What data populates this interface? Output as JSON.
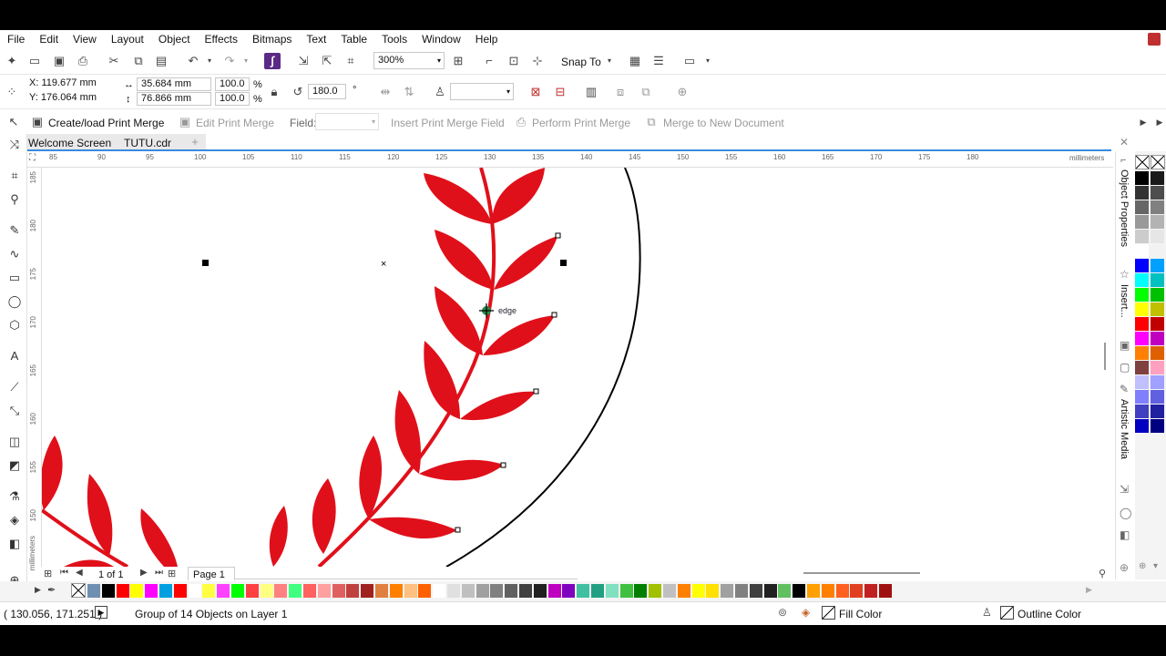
{
  "menu": [
    "File",
    "Edit",
    "View",
    "Layout",
    "Object",
    "Effects",
    "Bitmaps",
    "Text",
    "Table",
    "Tools",
    "Window",
    "Help"
  ],
  "toolbar": {
    "zoom": "300%",
    "snap_to": "Snap To"
  },
  "propbar": {
    "x": "X: 119.677 mm",
    "y": "Y: 176.064 mm",
    "width": "35.684 mm",
    "height": "76.866 mm",
    "scale_w": "100.0",
    "scale_h": "100.0",
    "percent": "%",
    "angle": "180.0",
    "degree": "°"
  },
  "printmerge": {
    "create": "Create/load Print Merge",
    "edit": "Edit Print Merge",
    "field": "Field:",
    "insert": "Insert Print Merge Field",
    "perform": "Perform Print Merge",
    "merge_doc": "Merge to New Document"
  },
  "tabs": [
    "Welcome Screen",
    "TUTU.cdr"
  ],
  "ruler": {
    "unit": "millimeters",
    "h_ticks": [
      "85",
      "90",
      "95",
      "100",
      "105",
      "110",
      "115",
      "120",
      "125",
      "130",
      "135",
      "140",
      "145",
      "150",
      "155",
      "160",
      "165",
      "170",
      "175",
      "180"
    ],
    "v_ticks": [
      "185",
      "180",
      "175",
      "170",
      "165",
      "160",
      "155",
      "150"
    ]
  },
  "canvas": {
    "snap_hint": "edge"
  },
  "docker": {
    "object_properties": "Object Properties",
    "insert": "Insert...",
    "artistic_media": "Artistic Media"
  },
  "pager": {
    "count": "1 of 1",
    "page_tab": "Page 1"
  },
  "status": {
    "coords": "( 130.056, 171.251 )",
    "selection": "Group of 14 Objects on Layer 1",
    "fill": "Fill Color",
    "outline": "Outline Color"
  },
  "colors": {
    "leaf": "#e0101a",
    "accent": "#1e6fc8"
  },
  "palette": [
    "#6e8fb0",
    "#000000",
    "#ff0000",
    "#ffff00",
    "#ff00ff",
    "#00a0e0",
    "#ff0000",
    "#ffffff",
    "#ffff40",
    "#ff40ff",
    "#00ff00",
    "#ff4040",
    "#ffff80",
    "#ff8080",
    "#40ff80",
    "#ff6060",
    "#ffa0a0",
    "#e06060",
    "#c04040",
    "#a02020",
    "#e08040",
    "#ff8000",
    "#ffc080",
    "#ff6000",
    "#ffffff",
    "#e0e0e0",
    "#c0c0c0",
    "#a0a0a0",
    "#808080",
    "#606060",
    "#404040",
    "#202020",
    "#c000c0",
    "#8000c0",
    "#40c0a0",
    "#20a080",
    "#80e0c0",
    "#40c040",
    "#008000",
    "#a0c000",
    "#c0c0c0",
    "#ff8000",
    "#ffff00",
    "#ffe000",
    "#a0a0a0",
    "#808080",
    "#404040",
    "#202020",
    "#60c060",
    "#000000",
    "#ffa000",
    "#ff8000",
    "#ff6020",
    "#e04020",
    "#c02020",
    "#a01010"
  ],
  "palette_v": [
    [
      "#000000",
      "#1a1a1a"
    ],
    [
      "#333333",
      "#4d4d4d"
    ],
    [
      "#666666",
      "#808080"
    ],
    [
      "#999999",
      "#b3b3b3"
    ],
    [
      "#cccccc",
      "#e6e6e6"
    ],
    [
      "#ffffff",
      "#f2f2f2"
    ],
    [
      "#0000ff",
      "#00a0ff"
    ],
    [
      "#00ffff",
      "#00c0c0"
    ],
    [
      "#00ff00",
      "#00c000"
    ],
    [
      "#ffff00",
      "#c0c000"
    ],
    [
      "#ff0000",
      "#c00000"
    ],
    [
      "#ff00ff",
      "#c000c0"
    ],
    [
      "#ff8000",
      "#e06000"
    ],
    [
      "#804040",
      "#ffa0c0"
    ],
    [
      "#c0c0ff",
      "#a0a0ff"
    ],
    [
      "#8080ff",
      "#6060e0"
    ],
    [
      "#4040c0",
      "#2020a0"
    ],
    [
      "#0000c0",
      "#000080"
    ]
  ]
}
